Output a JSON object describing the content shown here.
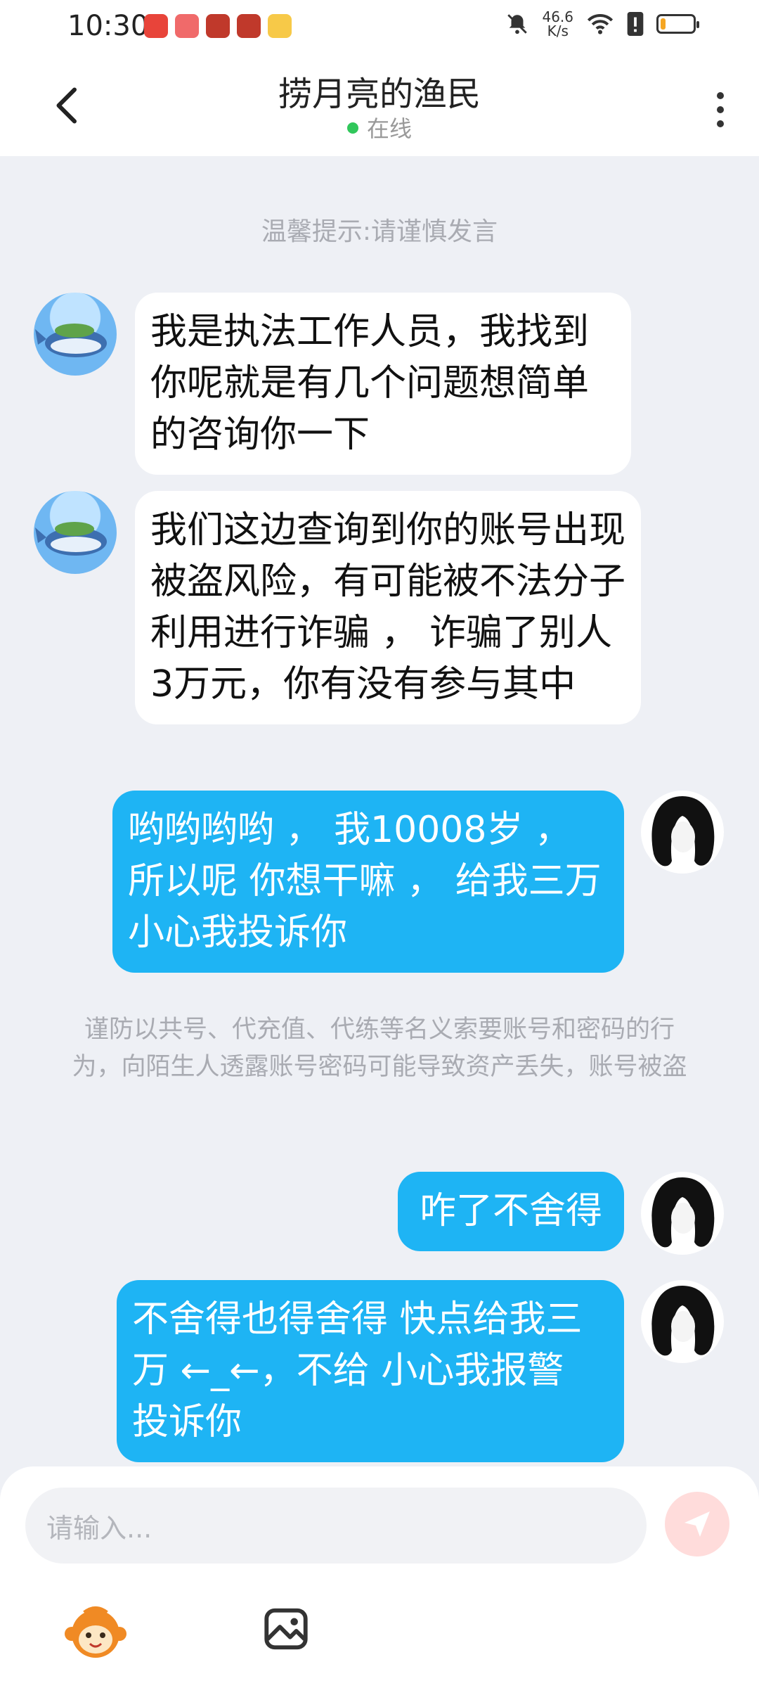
{
  "status_bar": {
    "time": "10:30",
    "network_speed_value": "46.6",
    "network_speed_unit": "K/s",
    "battery_level_percent": 15
  },
  "header": {
    "title": "捞月亮的渔民",
    "status": "在线"
  },
  "chat": {
    "tip": "温馨提示:请谨慎发言",
    "messages": [
      {
        "side": "left",
        "text": "我是执法工作人员，我找到你呢就是有几个问题想简单的咨询你一下"
      },
      {
        "side": "left",
        "text": "我们这边查询到你的账号出现被盗风险，有可能被不法分子利用进行诈骗 ， 诈骗了别人 3万元，你有没有参与其中"
      },
      {
        "side": "right",
        "text": "哟哟哟哟 ， 我10008岁 ， 所以呢 你想干嘛 ， 给我三万 小心我投诉你"
      },
      {
        "side": "right",
        "text": "咋了不舍得"
      },
      {
        "side": "right",
        "text": "不舍得也得舍得 快点给我三万 ←_←，不给 小心我报警 投诉你"
      }
    ],
    "warning": "谨防以共号、代充值、代练等名义索要账号和密码的行为，向陌生人透露账号密码可能导致资产丢失，账号被盗"
  },
  "input": {
    "placeholder": "请输入..."
  },
  "icons": {
    "back": "back-arrow-icon",
    "more": "more-vertical-icon",
    "send": "send-icon",
    "emoji": "monkey-emoji-icon",
    "image": "image-icon"
  },
  "colors": {
    "accent_blue": "#1eb4f4",
    "online_green": "#31c75b",
    "send_disabled": "#ffdcdb"
  }
}
